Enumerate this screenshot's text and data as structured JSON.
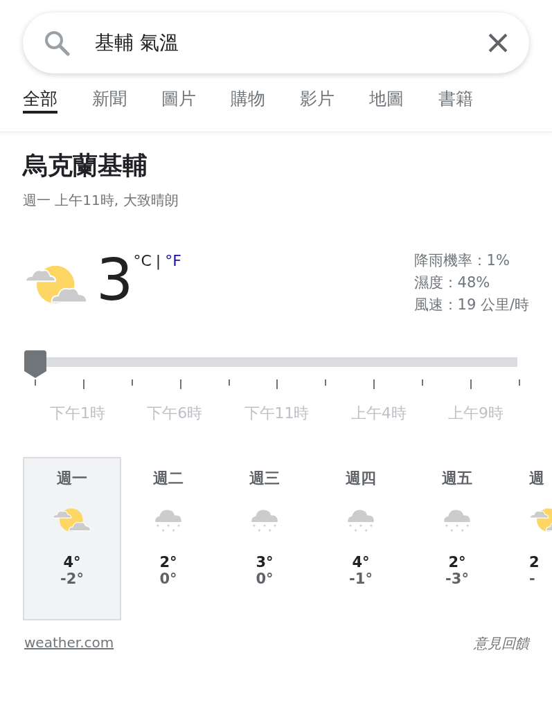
{
  "search": {
    "value": "基輔 氣溫"
  },
  "tabs": [
    {
      "label": "全部",
      "selected": true
    },
    {
      "label": "新聞",
      "selected": false
    },
    {
      "label": "圖片",
      "selected": false
    },
    {
      "label": "購物",
      "selected": false
    },
    {
      "label": "影片",
      "selected": false
    },
    {
      "label": "地圖",
      "selected": false
    },
    {
      "label": "書籍",
      "selected": false
    }
  ],
  "location": "烏克蘭基輔",
  "subtitle": "週一 上午11時, 大致晴朗",
  "current": {
    "kind": "partly_sunny",
    "temperature": "3",
    "separator": "|",
    "units": [
      {
        "label": "°C",
        "selected": true
      },
      {
        "label": "°F",
        "selected": false
      }
    ]
  },
  "details": [
    "降雨機率：1%",
    "濕度：48%",
    "風速：19 公里/時"
  ],
  "timeline": {
    "level": 0,
    "labels": [
      "下午1時",
      "下午6時",
      "下午11時",
      "上午4時",
      "上午9時"
    ]
  },
  "forecast": [
    {
      "day": "週一",
      "kind": "partly_sunny",
      "high": "4°",
      "low": "-2°",
      "selected": true
    },
    {
      "day": "週二",
      "kind": "snow",
      "high": "2°",
      "low": "0°",
      "selected": false
    },
    {
      "day": "週三",
      "kind": "snow",
      "high": "3°",
      "low": "0°",
      "selected": false
    },
    {
      "day": "週四",
      "kind": "snow",
      "high": "4°",
      "low": "-1°",
      "selected": false
    },
    {
      "day": "週五",
      "kind": "snow",
      "high": "2°",
      "low": "-3°",
      "selected": false
    },
    {
      "day": "週",
      "kind": "partly_sunny",
      "high": "2",
      "low": "-",
      "selected": false
    }
  ],
  "source": "weather.com",
  "feedback": "意見回饋"
}
